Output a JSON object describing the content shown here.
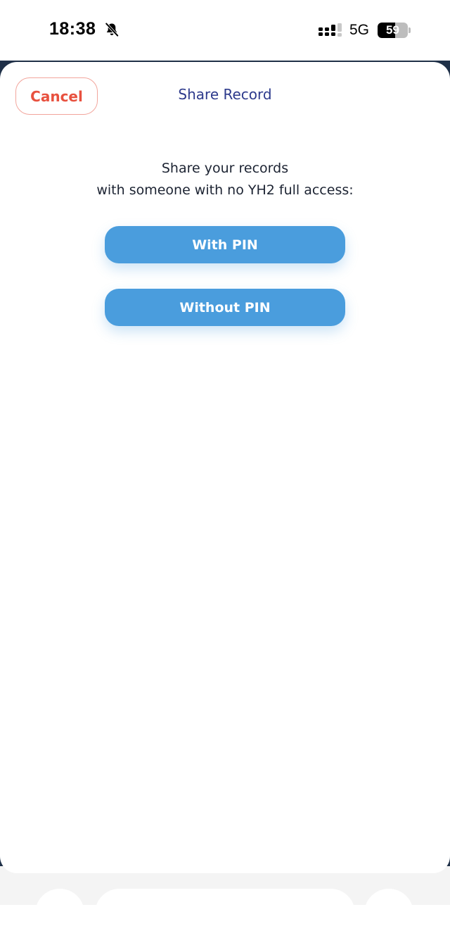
{
  "status_bar": {
    "time": "18:38",
    "network": "5G",
    "battery_level": "59",
    "battery_fraction": 0.59,
    "icons": [
      "bell-slash-icon",
      "signal-icon",
      "battery-icon"
    ]
  },
  "header": {
    "cancel_label": "Cancel",
    "title": "Share Record"
  },
  "prompt": {
    "line1": "Share your records",
    "line2": "with someone with no YH2 full access:"
  },
  "actions": {
    "with_pin_label": "With PIN",
    "without_pin_label": "Without PIN"
  },
  "colors": {
    "accent_blue": "#4a9ddd",
    "cancel_red": "#e8513f",
    "title_navy": "#2d3a8c",
    "backdrop": "#1f3048"
  }
}
